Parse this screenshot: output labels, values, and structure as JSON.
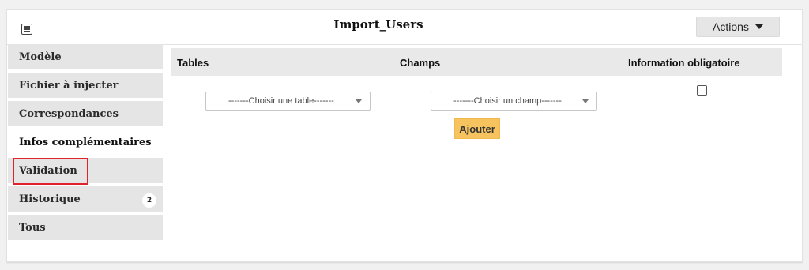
{
  "header": {
    "menu_icon": "list-icon",
    "title": "Import_Users",
    "actions_label": "Actions",
    "actions_icon": "caret-down-icon"
  },
  "sidebar": {
    "items": [
      {
        "label": "Modèle"
      },
      {
        "label": "Fichier à injecter"
      },
      {
        "label": "Correspondances"
      },
      {
        "label": "Infos complémentaires",
        "active": true
      },
      {
        "label": "Validation",
        "highlighted": true
      },
      {
        "label": "Historique",
        "badge": "2"
      },
      {
        "label": "Tous"
      }
    ]
  },
  "table": {
    "headers": [
      "Tables",
      "Champs",
      "Information obligatoire"
    ],
    "table_select": {
      "value": "-------Choisir une table-------"
    },
    "field_select": {
      "value": "-------Choisir un champ-------"
    },
    "required_checked": false
  },
  "add_label": "Ajouter",
  "colors": {
    "accent_button": "#f7c35f",
    "highlight_border": "#e0222a",
    "sidebar_bg": "#e5e5e5"
  }
}
